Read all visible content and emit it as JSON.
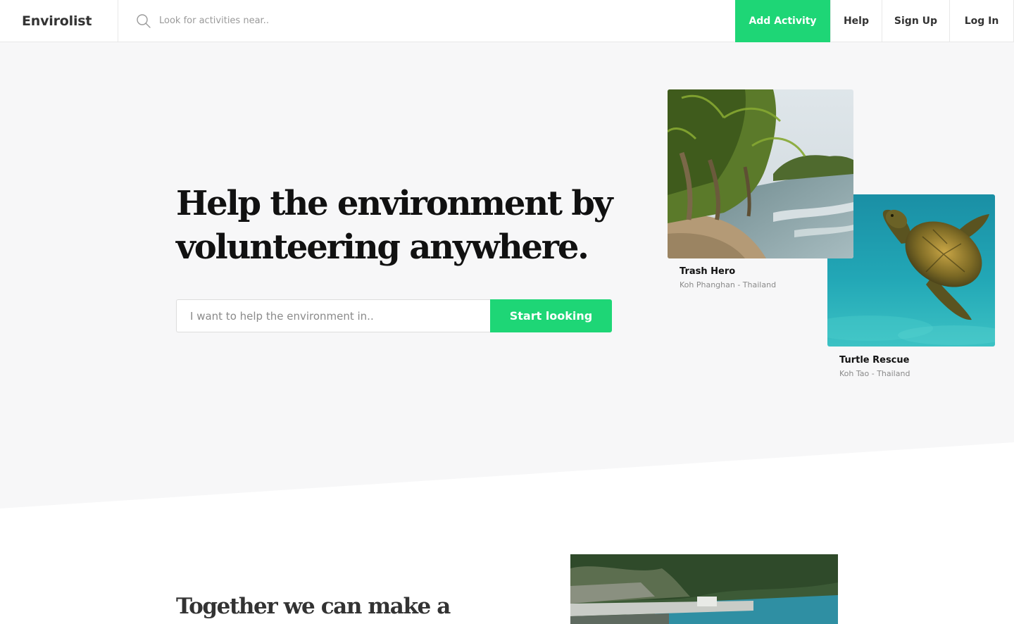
{
  "nav": {
    "brand": "Envirolist",
    "search_placeholder": "Look for activities near..",
    "add_activity": "Add Activity",
    "help": "Help",
    "sign_up": "Sign Up",
    "log_in": "Log In"
  },
  "hero": {
    "headline": "Help the environment by volunteering anywhere.",
    "input_placeholder": "I want to help the environment in..",
    "cta": "Start looking"
  },
  "cards": [
    {
      "title": "Trash Hero",
      "location": "Koh Phanghan - Thailand"
    },
    {
      "title": "Turtle Rescue",
      "location": "Koh Tao - Thailand"
    }
  ],
  "section2": {
    "title": "Together we can make a"
  },
  "colors": {
    "accent": "#1ed676",
    "hero_bg": "#f7f7f8",
    "text": "#111111",
    "muted": "#8a8a8a"
  }
}
